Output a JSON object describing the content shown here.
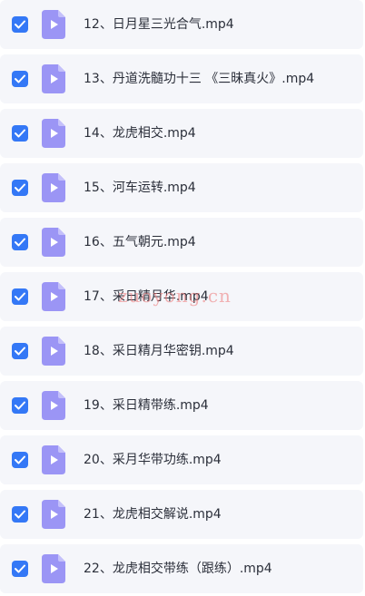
{
  "files": [
    {
      "name": "12、日月星三光合气.mp4",
      "checked": true
    },
    {
      "name": "13、丹道洗髓功十三 《三昧真火》.mp4",
      "checked": true
    },
    {
      "name": "14、龙虎相交.mp4",
      "checked": true
    },
    {
      "name": "15、河车运转.mp4",
      "checked": true
    },
    {
      "name": "16、五气朝元.mp4",
      "checked": true
    },
    {
      "name": "17、采日精月华.mp4",
      "checked": true
    },
    {
      "name": "18、采日精月华密钥.mp4",
      "checked": true
    },
    {
      "name": "19、采日精带练.mp4",
      "checked": true
    },
    {
      "name": "20、采月华带功练.mp4",
      "checked": true
    },
    {
      "name": "21、龙虎相交解说.mp4",
      "checked": true
    },
    {
      "name": "22、龙虎相交带练（跟练）.mp4",
      "checked": true
    }
  ],
  "icons": {
    "checkbox": "check-icon",
    "file": "video-file-icon"
  },
  "colors": {
    "checkbox": "#3478f6",
    "row_background": "#f5f6fa",
    "video_icon": "#9b95f5",
    "watermark": "#ec7878"
  },
  "watermark_text": "zuoyong.cn"
}
